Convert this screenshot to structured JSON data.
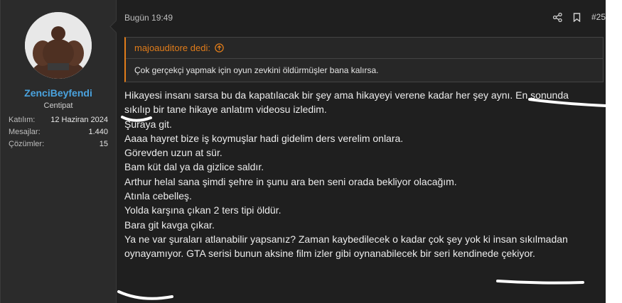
{
  "user": {
    "name": "ZenciBeyfendi",
    "title": "Centipat",
    "stats": [
      {
        "label": "Katılım:",
        "value": "12 Haziran 2024"
      },
      {
        "label": "Mesajlar:",
        "value": "1.440"
      },
      {
        "label": "Çözümler:",
        "value": "15"
      }
    ]
  },
  "post": {
    "time": "Bugün 19:49",
    "number": "#25",
    "quote": {
      "author": "majoauditore dedi:",
      "text": "Çok gerçekçi yapmak için oyun zevkini öldürmüşler bana kalırsa."
    },
    "lines": [
      "Hikayesi insanı sarsa bu da kapatılacak bir şey ama hikayeyi verene kadar her şey aynı. En sonunda",
      "sıkılıp bir tane hikaye anlatım videosu izledim.",
      "",
      "Şuraya git.",
      "Aaaa hayret bize iş koymuşlar hadi gidelim ders verelim onlara.",
      "Görevden uzun at sür.",
      "Bam küt dal ya da gizlice saldır.",
      "Arthur helal sana şimdi şehre in şunu ara ben seni orada bekliyor olacağım.",
      "Atınla cebelleş.",
      "Yolda karşına çıkan 2 ters tipi öldür.",
      "Bara git kavga çıkar.",
      "",
      "Ya ne var şuraları atlanabilir yapsanız? Zaman kaybedilecek o kadar çok şey yok ki insan sıkılmadan",
      "oynayamıyor. GTA serisi bunun aksine film izler gibi oynanabilecek bir seri kendinede çekiyor."
    ]
  },
  "icons": {
    "share": "share-icon",
    "bookmark": "bookmark-icon",
    "quote_up": "arrow-up-circle-icon"
  },
  "colors": {
    "username": "#4aa3df",
    "quote_accent": "#e07c1a",
    "background": "#1f1f1f",
    "sidebar": "#2b2b2b"
  }
}
